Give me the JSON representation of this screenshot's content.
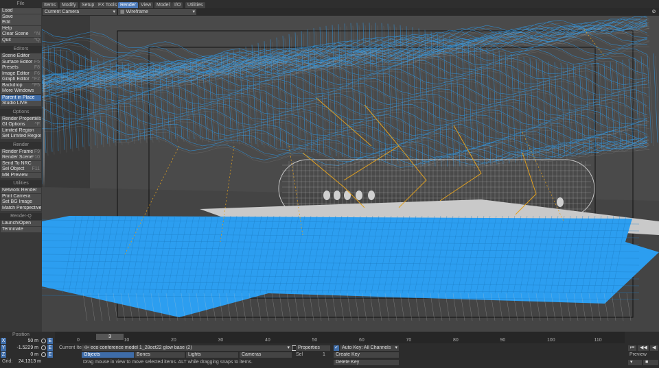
{
  "menu_tabs": [
    {
      "label": "Items",
      "active": false
    },
    {
      "label": "Modify",
      "active": false
    },
    {
      "label": "Setup",
      "active": false
    },
    {
      "label": "FX Tools",
      "active": false
    },
    {
      "label": "Render",
      "active": true
    },
    {
      "label": "View",
      "active": false
    },
    {
      "label": "Model",
      "active": false
    },
    {
      "label": "I/O",
      "active": false
    },
    {
      "label": "Utilities",
      "active": false
    }
  ],
  "viewport": {
    "camera": "Current Camera",
    "mode": "Wireframe"
  },
  "sidebar": {
    "file_header": "File",
    "file_items": [
      {
        "label": "Load",
        "shortcut": ""
      },
      {
        "label": "Save",
        "shortcut": ""
      },
      {
        "label": "Edit",
        "shortcut": ""
      },
      {
        "label": "Help",
        "shortcut": ""
      },
      {
        "label": "Clear Scene",
        "shortcut": "^N"
      },
      {
        "label": "Quit",
        "shortcut": "^Q"
      }
    ],
    "editors_header": "Editors",
    "editors_items": [
      {
        "label": "Scene Editor",
        "shortcut": ""
      },
      {
        "label": "Surface Editor",
        "shortcut": "F5"
      },
      {
        "label": "Presets",
        "shortcut": "F8"
      },
      {
        "label": "Image Editor",
        "shortcut": "F6"
      },
      {
        "label": "Graph Editor",
        "shortcut": "^F2"
      },
      {
        "label": "Backdrop",
        "shortcut": "^F5"
      },
      {
        "label": "More Windows",
        "shortcut": ""
      }
    ],
    "extra_items": [
      {
        "label": "Parent in Place",
        "active": true
      },
      {
        "label": "Studio LIVE",
        "active": false
      }
    ],
    "options_header": "Options",
    "options_items": [
      {
        "label": "Render Properties",
        "shortcut": "^F"
      },
      {
        "label": "GI Options",
        "shortcut": "^F"
      },
      {
        "label": "Limited Region",
        "shortcut": ""
      },
      {
        "label": "Set Limited Region",
        "shortcut": ""
      }
    ],
    "render_header": "Render",
    "render_items": [
      {
        "label": "Render Frame",
        "shortcut": "F9"
      },
      {
        "label": "Render Scene",
        "shortcut": "F10"
      },
      {
        "label": "Send To NRC",
        "shortcut": ""
      },
      {
        "label": "Sel Object",
        "shortcut": "F11"
      },
      {
        "label": "MB Preview",
        "shortcut": ""
      }
    ],
    "utilities_header": "Utilities",
    "utilities_items": [
      {
        "label": "Network Render"
      },
      {
        "label": "Print Camera"
      },
      {
        "label": "Set BG Image"
      },
      {
        "label": "Match Perspective"
      }
    ],
    "renderq_header": "Render-Q",
    "renderq_items": [
      {
        "label": "Launch/Open"
      },
      {
        "label": "Terminate"
      }
    ]
  },
  "position": {
    "header": "Position",
    "x": "50 m",
    "y": "-1.5229 m",
    "z": "0 m",
    "grid_label": "Grid:",
    "grid": "24.1313 m"
  },
  "timeline": {
    "ticks": [
      "0",
      "10",
      "20",
      "30",
      "40",
      "50",
      "60",
      "70",
      "80",
      "90",
      "100",
      "110"
    ],
    "current_frame": "3"
  },
  "current_item": {
    "label": "Current Item",
    "value": "eco conference model 1_28oct22 glow base (2)"
  },
  "item_types": [
    "Objects",
    "Bones",
    "Lights",
    "Cameras"
  ],
  "sel": {
    "label": "Sel",
    "value": "1"
  },
  "properties": "Properties",
  "autokey": "Auto Key: All Channels",
  "create_key": "Create Key",
  "delete_key": "Delete Key",
  "status": "Drag mouse in view to move selected items. ALT while dragging snaps to items.",
  "preview": "Preview",
  "colors": {
    "accent": "#3e6ca8",
    "mesh": "#2c9ef0",
    "wire": "#c8c8c8",
    "bones": "#e0a020"
  }
}
